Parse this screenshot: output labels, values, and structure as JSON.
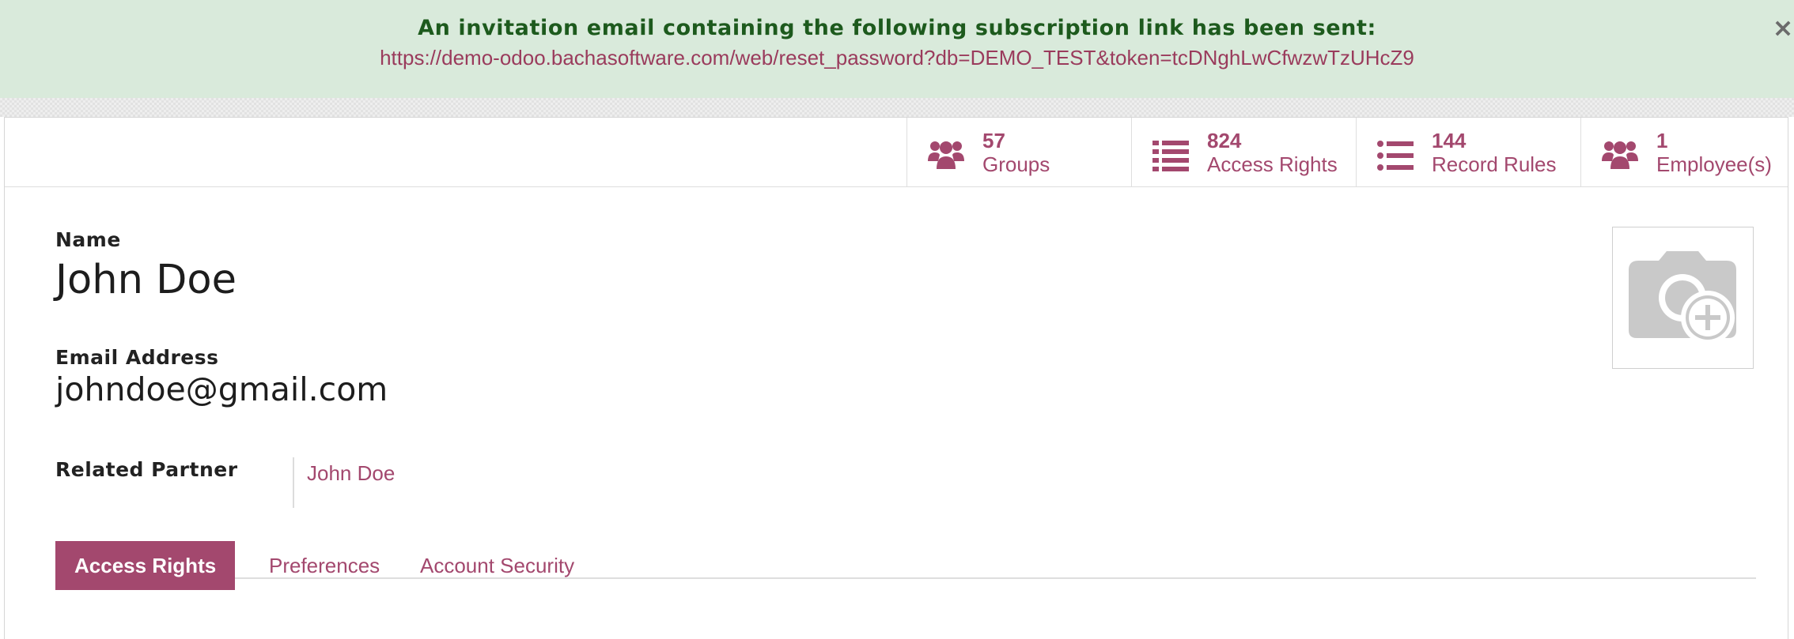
{
  "notification": {
    "message": "An invitation email containing the following subscription link has been sent:",
    "link": "https://demo-odoo.bachasoftware.com/web/reset_password?db=DEMO_TEST&token=tcDNghLwCfwzwTzUHcZ9",
    "close_label": "×"
  },
  "stat_buttons": [
    {
      "value": "57",
      "label": "Groups",
      "icon": "users-icon"
    },
    {
      "value": "824",
      "label": "Access Rights",
      "icon": "list-icon"
    },
    {
      "value": "144",
      "label": "Record Rules",
      "icon": "list-icon"
    },
    {
      "value": "1",
      "label": "Employee(s)",
      "icon": "users-icon"
    }
  ],
  "form": {
    "name_label": "Name",
    "name_value": "John Doe",
    "email_label": "Email Address",
    "email_value": "johndoe@gmail.com",
    "partner_label": "Related Partner",
    "partner_value": "John Doe",
    "avatar_icon": "camera-plus-icon"
  },
  "tabs": [
    {
      "label": "Access Rights",
      "active": true
    },
    {
      "label": "Preferences",
      "active": false
    },
    {
      "label": "Account Security",
      "active": false
    }
  ],
  "colors": {
    "accent": "#a3486e",
    "alert_background": "#d9eadb",
    "alert_text": "#1d5a1d"
  }
}
